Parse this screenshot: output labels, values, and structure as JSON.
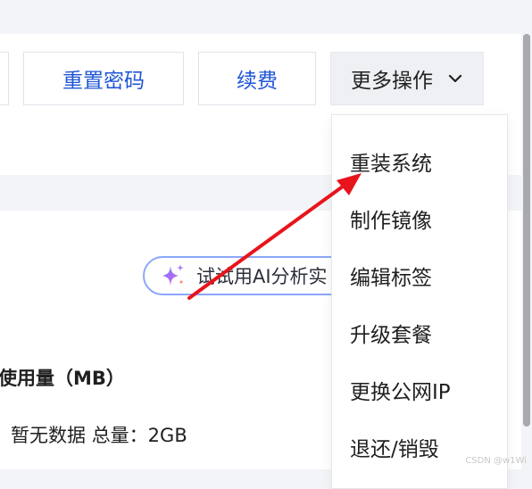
{
  "toolbar": {
    "reset_password": "重置密码",
    "renew": "续费",
    "more_actions": "更多操作"
  },
  "ai_button": {
    "label": "试试用AI分析实"
  },
  "usage": {
    "title": "使用量（MB）",
    "no_data": "暂无数据",
    "total": "总量：2GB"
  },
  "menu": {
    "items": [
      "重装系统",
      "制作镜像",
      "编辑标签",
      "升级套餐",
      "更换公网IP",
      "退还/销毁"
    ]
  },
  "annotation": {
    "arrow_color": "#e8141c"
  },
  "watermark": "CSDN @w1Wi",
  "colors": {
    "link_blue": "#1f56d6",
    "pill_border": "#8aa7f8"
  }
}
